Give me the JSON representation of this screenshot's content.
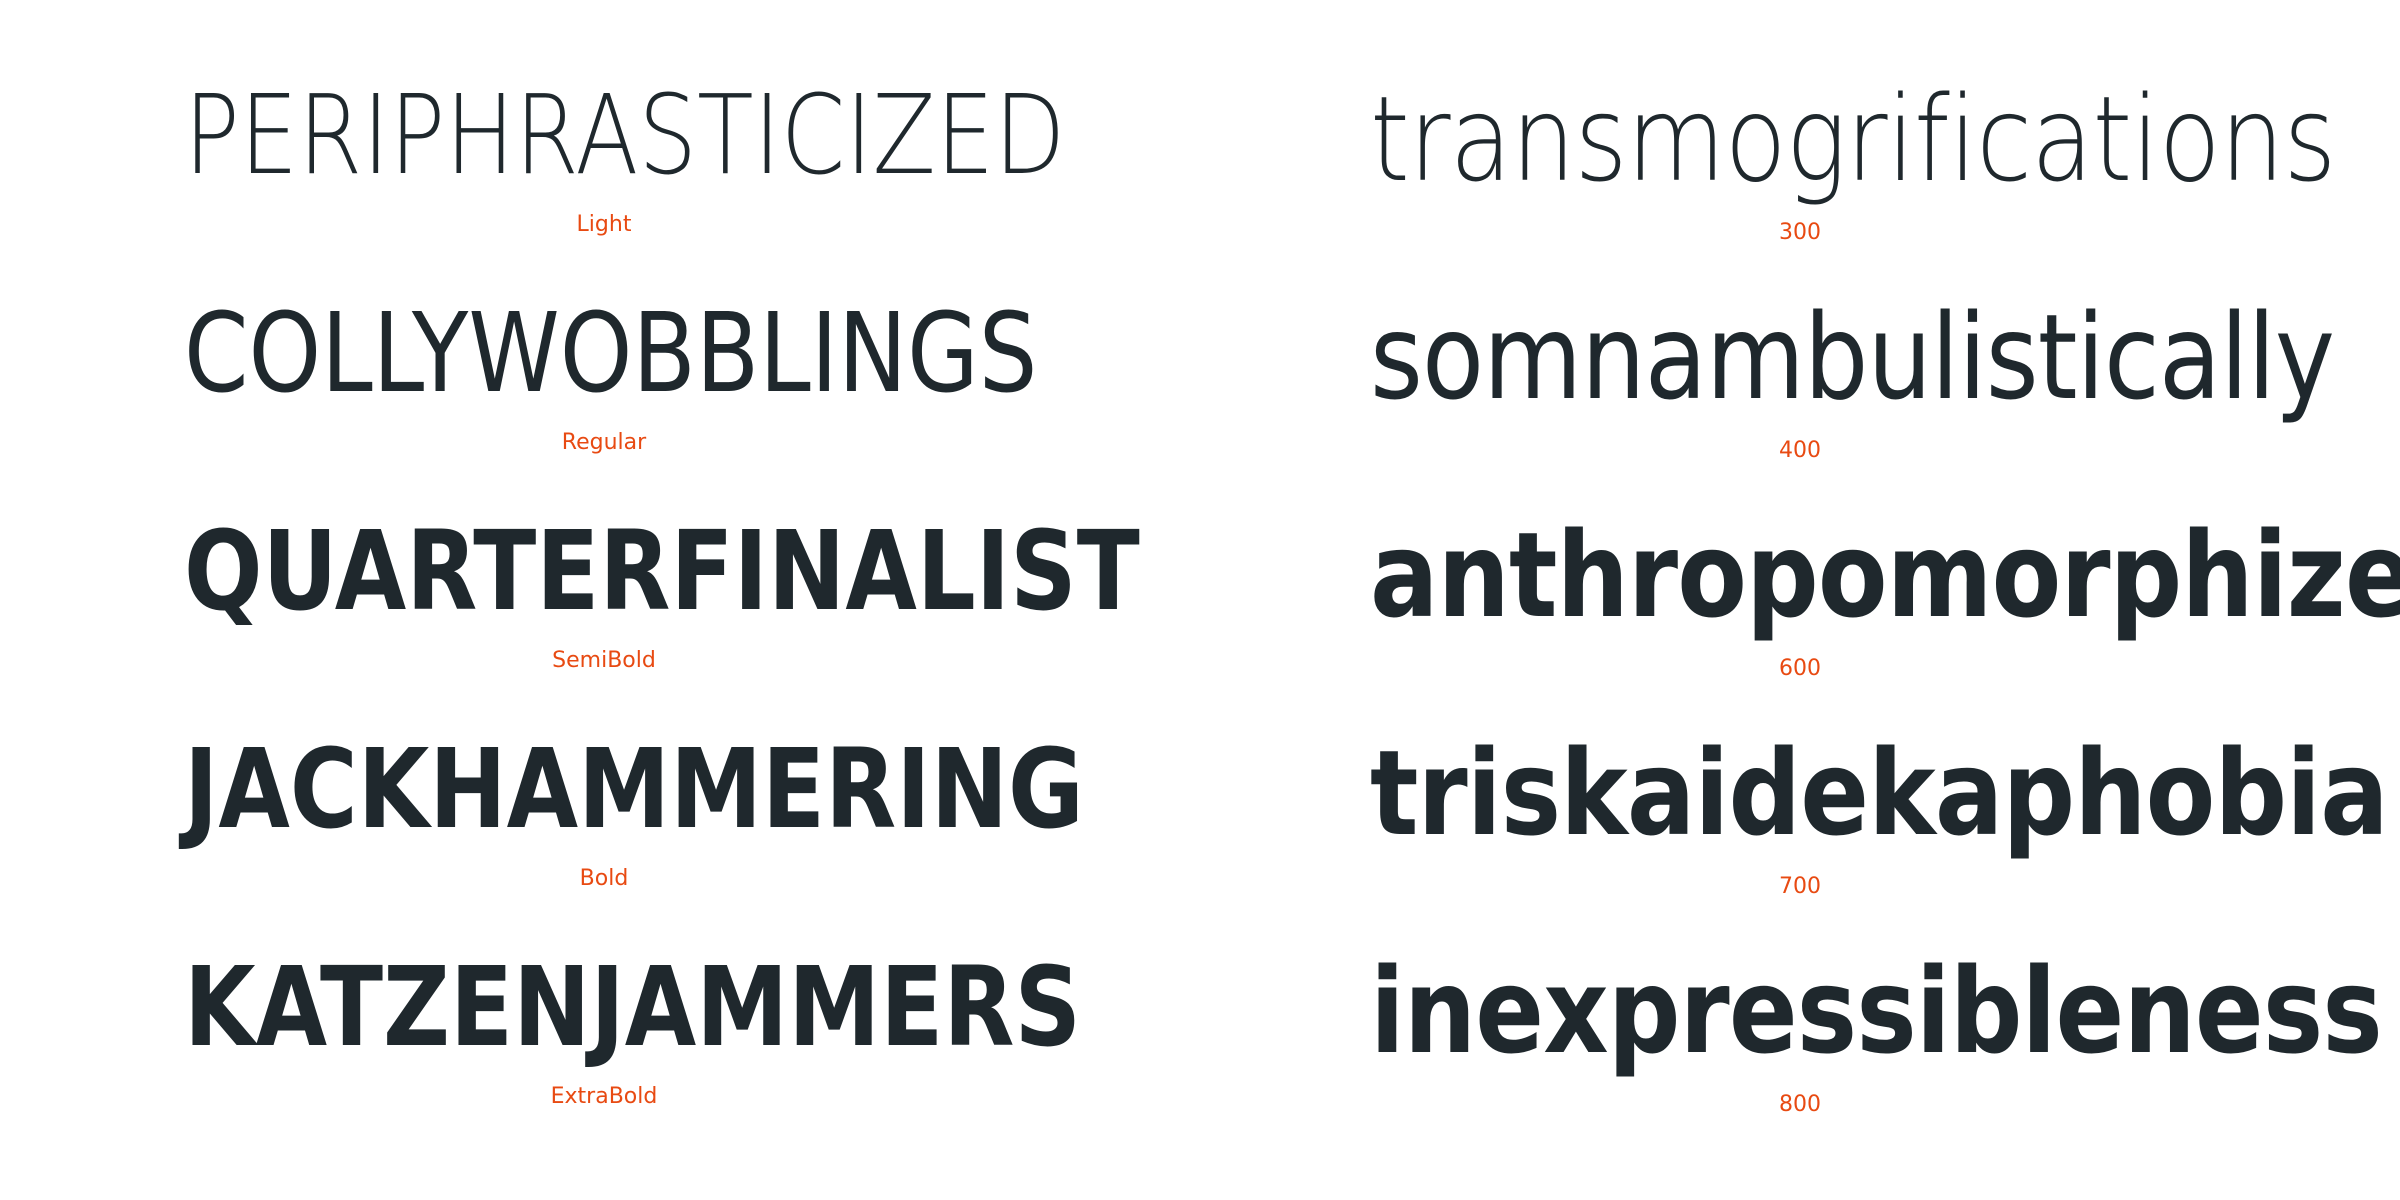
{
  "left_column": [
    {
      "word": "PERIPHRASTICIZED",
      "label": "Light"
    },
    {
      "word": "COLLYWOBBLINGS",
      "label": "Regular"
    },
    {
      "word": "QUARTERFINALIST",
      "label": "SemiBold"
    },
    {
      "word": "JACKHAMMERING",
      "label": "Bold"
    },
    {
      "word": "KATZENJAMMERS",
      "label": "ExtraBold"
    }
  ],
  "right_column": [
    {
      "word": "transmogrifications",
      "label": "300"
    },
    {
      "word": "somnambulistically",
      "label": "400"
    },
    {
      "word": "anthropomorphize",
      "label": "600"
    },
    {
      "word": "triskaidekaphobia",
      "label": "700"
    },
    {
      "word": "inexpressibleness",
      "label": "800"
    }
  ],
  "colors": {
    "text": "#1f282d",
    "label": "#e84a12",
    "background": "#ffffff"
  }
}
